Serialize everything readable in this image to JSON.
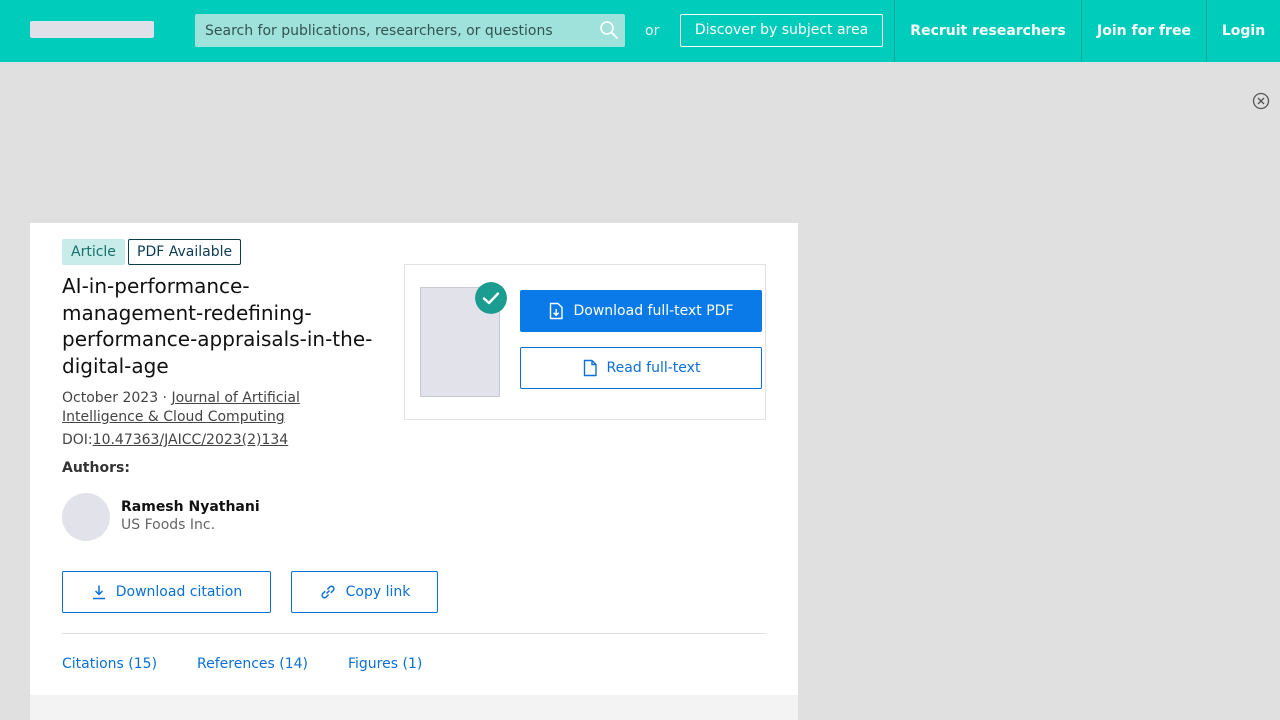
{
  "header": {
    "search_placeholder": "Search for publications, researchers, or questions",
    "or_text": "or",
    "discover_label": "Discover by subject area",
    "nav": [
      "Recruit researchers",
      "Join for free",
      "Login"
    ],
    "search_icon": "search-icon"
  },
  "ad": {
    "close_icon": "close-circle-icon"
  },
  "publication": {
    "badges": {
      "type": "Article",
      "availability": "PDF Available"
    },
    "title": "AI-in-performance-management-redefining-performance-appraisals-in-the-digital-age",
    "date": "October 2023",
    "separator": " · ",
    "journal": "Journal of Artificial Intelligence & Cloud Computing",
    "doi_label": "DOI:",
    "doi": "10.47363/JAICC/2023(2)134",
    "authors_label": "Authors:",
    "authors": [
      {
        "name": "Ramesh Nyathani",
        "affiliation": "US Foods Inc."
      }
    ]
  },
  "actions": {
    "download_pdf": "Download full-text PDF",
    "read_full_text": "Read full-text",
    "download_citation": "Download citation",
    "copy_link": "Copy link"
  },
  "tabs": [
    "Citations (15)",
    "References (14)",
    "Figures (1)"
  ],
  "colors": {
    "brand": "#00ccbb",
    "primary_button": "#0a7ae8",
    "link": "#0a6fd6",
    "check_badge": "#1b9c90"
  }
}
